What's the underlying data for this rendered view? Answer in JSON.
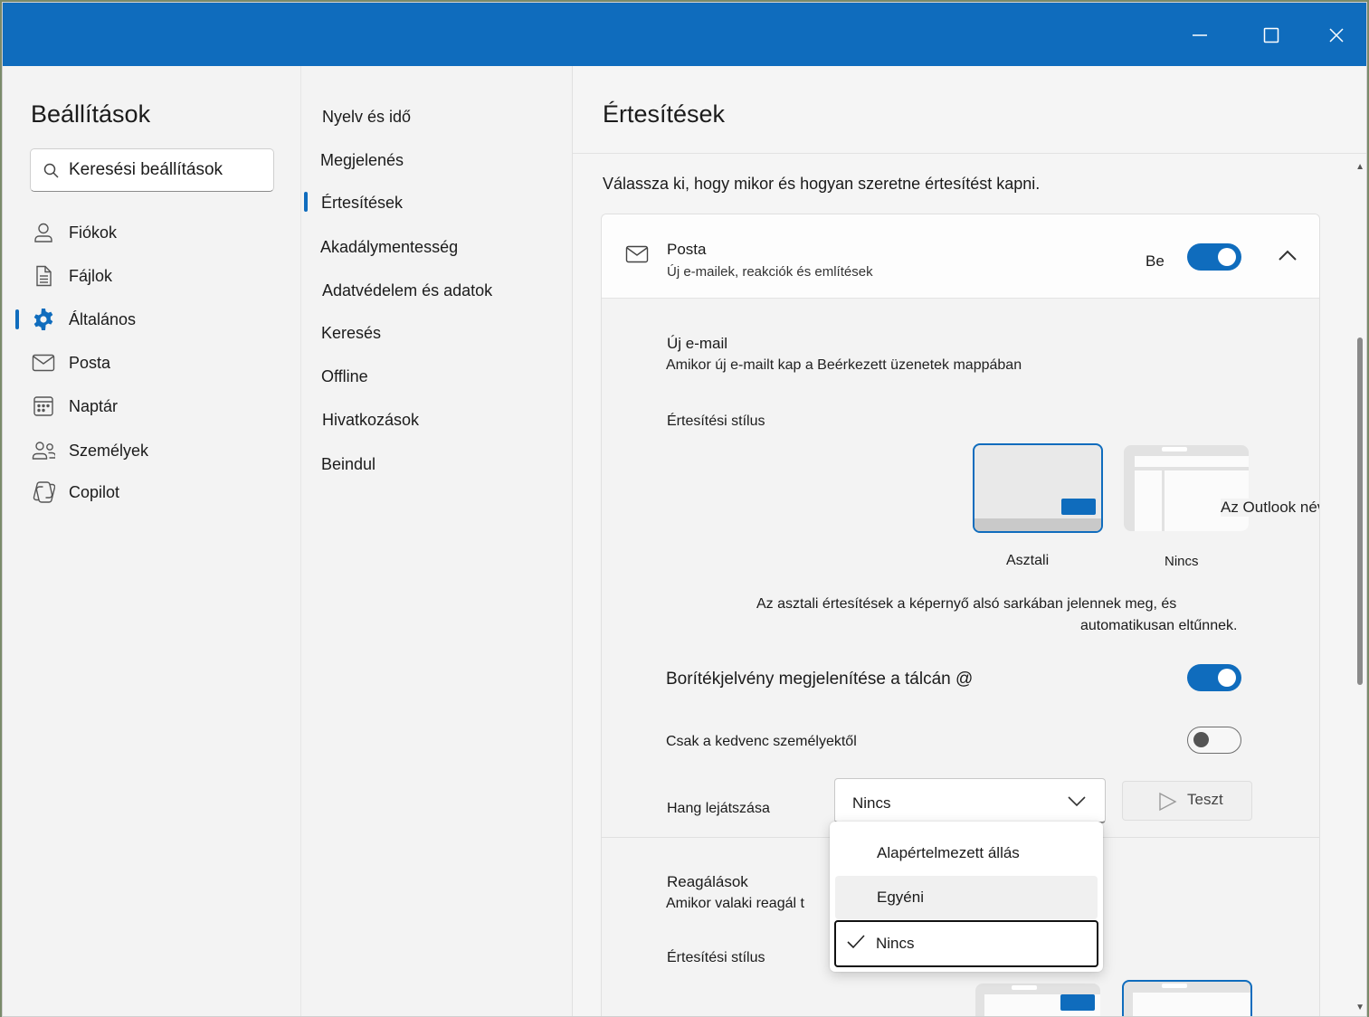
{
  "titlebar": {
    "minimize_icon": "minimize-icon",
    "maximize_icon": "maximize-icon",
    "close_icon": "close-icon",
    "color": "#0f6cbd"
  },
  "sidebar": {
    "title": "Beállítások",
    "search_placeholder": "Keresési beállítások",
    "items": [
      {
        "label": "Fiókok",
        "icon": "person-icon"
      },
      {
        "label": "Fájlok",
        "icon": "document-icon"
      },
      {
        "label": "Általános",
        "icon": "gear-icon",
        "selected": true
      },
      {
        "label": "Posta",
        "icon": "mail-icon"
      },
      {
        "label": "Naptár",
        "icon": "calendar-icon"
      },
      {
        "label": "Személyek",
        "icon": "people-icon"
      },
      {
        "label": "Copilot",
        "icon": "copilot-icon"
      }
    ]
  },
  "subnav": {
    "items": [
      {
        "label": "Nyelv és idő"
      },
      {
        "label": "Megjelenés"
      },
      {
        "label": "Értesítések",
        "selected": true
      },
      {
        "label": "Akadálymentesség"
      },
      {
        "label": "Adatvédelem és adatok"
      },
      {
        "label": "Keresés"
      },
      {
        "label": "Offline"
      },
      {
        "label": "Hivatkozások"
      },
      {
        "label": "Beindul"
      }
    ]
  },
  "main": {
    "title": "Értesítések",
    "intro": "Válassza ki, hogy mikor és hogyan szeretne értesítést kapni.",
    "mail_card": {
      "title": "Posta",
      "subtitle": "Új e-mailek, reakciók és említések",
      "state_label": "Be",
      "enabled": true
    },
    "new_email": {
      "title": "Új e-mail",
      "description": "Amikor új e-mailt kap a Beérkezett üzenetek mappában",
      "style_label": "Értesítési stílus",
      "style_options": [
        {
          "label": "Asztali",
          "selected": true
        },
        {
          "label": "Nincs",
          "selected": false
        }
      ],
      "overlay_text": "Az Outlook névjegye",
      "desktop_note_line1": "Az asztali értesítések a képernyő alsó sarkában jelennek meg, és",
      "desktop_note_line2": "automatikusan eltűnnek.",
      "badge_label": "Borítékjelvény megjelenítése a tálcán @",
      "badge_enabled": true,
      "favorites_label": "Csak a kedvenc személyektől",
      "favorites_enabled": false,
      "sound_label": "Hang lejátszása",
      "sound_value": "Nincs",
      "test_button": "Teszt"
    },
    "reactions": {
      "title": "Reagálások",
      "description": "Amikor valaki reagál t",
      "style_label": "Értesítési stílus"
    },
    "sound_menu": {
      "options": [
        {
          "label": "Alapértelmezett állás",
          "checked": false
        },
        {
          "label": "Egyéni",
          "checked": false
        },
        {
          "label": "Nincs",
          "checked": true
        }
      ]
    }
  },
  "colors": {
    "accent": "#0f6cbd",
    "background": "#f3f3f3"
  }
}
